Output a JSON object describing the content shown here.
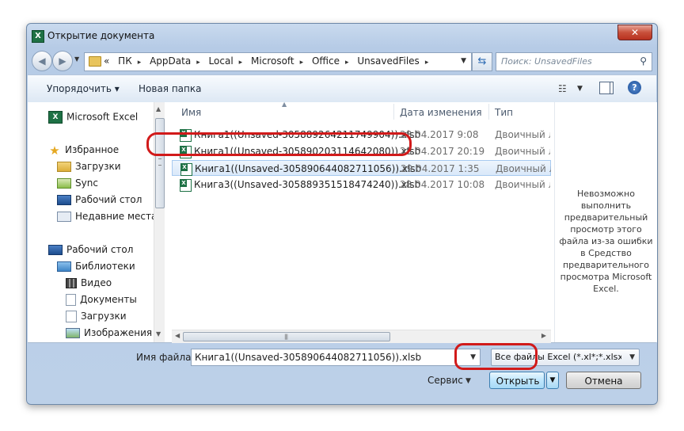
{
  "window": {
    "title": "Открытие документа",
    "close_label": "✕"
  },
  "address": {
    "crumbs": [
      "«",
      "ПК",
      "AppData",
      "Local",
      "Microsoft",
      "Office",
      "UnsavedFiles"
    ],
    "separator": "▸"
  },
  "search": {
    "placeholder": "Поиск: UnsavedFiles"
  },
  "toolbar": {
    "organize_label": "Упорядочить ▾",
    "new_folder_label": "Новая папка"
  },
  "nav": {
    "items": [
      {
        "label": "Microsoft Excel",
        "icon": "excel-icon"
      },
      {
        "label": "Избранное",
        "icon": "star-icon"
      },
      {
        "label": "Загрузки",
        "icon": "folder-icon"
      },
      {
        "label": "Sync",
        "icon": "sync-folder-icon"
      },
      {
        "label": "Рабочий стол",
        "icon": "desktop-icon"
      },
      {
        "label": "Недавние места",
        "icon": "recent-places-icon"
      },
      {
        "label": "Рабочий стол",
        "icon": "desktop-icon"
      },
      {
        "label": "Библиотеки",
        "icon": "libraries-icon"
      },
      {
        "label": "Видео",
        "icon": "video-icon"
      },
      {
        "label": "Документы",
        "icon": "documents-icon"
      },
      {
        "label": "Загрузки",
        "icon": "downloads-icon"
      },
      {
        "label": "Изображения",
        "icon": "images-icon"
      }
    ]
  },
  "columns": {
    "name": "Имя",
    "date": "Дата изменения",
    "type": "Тип"
  },
  "files": [
    {
      "name": "Книга1((Unsaved-305889264211749904)).xlsb",
      "date": "28.04.2017 9:08",
      "type": "Двоичный ли"
    },
    {
      "name": "Книга1((Unsaved-305890203114642080)).xlsb",
      "date": "28.04.2017 20:19",
      "type": "Двоичный ли"
    },
    {
      "name": "Книга1((Unsaved-305890644082711056)).xlsb",
      "date": "29.04.2017 1:35",
      "type": "Двоичный ли"
    },
    {
      "name": "Книга3((Unsaved-305889351518474240)).xlsb",
      "date": "28.04.2017 10:08",
      "type": "Двоичный ли"
    }
  ],
  "preview": {
    "message": "Невозможно выполнить предварительный просмотр этого файла из-за ошибки в Средство предварительного просмотра Microsoft Excel."
  },
  "footer": {
    "filename_label": "Имя файла:",
    "filename_value": "Книга1((Unsaved-305890644082711056)).xlsb",
    "filter_value": "Все файлы Excel (*.xl*;*.xlsx;*.xl",
    "service_label": "Сервис",
    "open_label": "Открыть",
    "cancel_label": "Отмена"
  },
  "colors": {
    "highlight": "#d11a1a",
    "excel_green": "#1e7145"
  }
}
